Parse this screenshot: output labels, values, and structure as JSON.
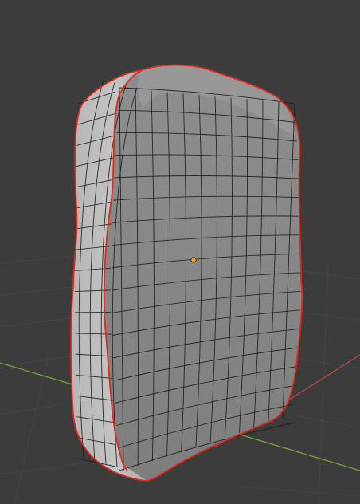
{
  "viewport": {
    "view": "3d-viewport",
    "mode": "edit-mode",
    "background_color": "#3c3c3c",
    "grid_line_color": "#444444",
    "x_axis_color": "#b04a55",
    "y_axis_color": "#7ba43a"
  },
  "mesh": {
    "shape": "rounded-block",
    "shading": "solid",
    "face_color_front": "#8a8a8a",
    "face_color_side": "#bdbdbd",
    "face_color_top": "#9c9c9c",
    "wire_color": "#1a1a1a",
    "selected_edge_color": "#e0281c",
    "origin_color": "#f29a1e"
  }
}
